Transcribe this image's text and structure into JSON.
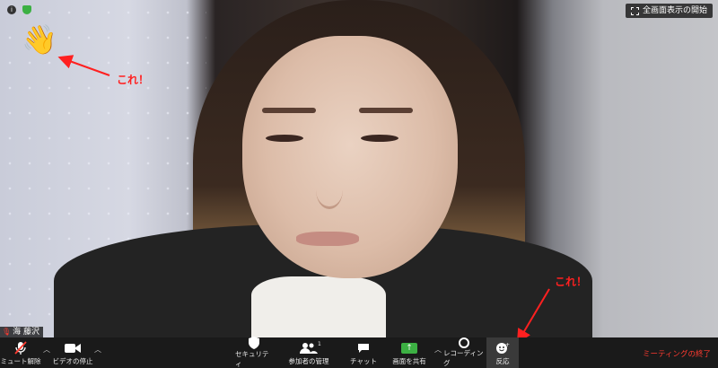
{
  "window": {
    "fullscreen_label": "全画面表示の開始"
  },
  "participant": {
    "name": "海 藤沢"
  },
  "reaction": {
    "emoji": "👋"
  },
  "annotations": [
    {
      "text": "これ！"
    },
    {
      "text": "これ！"
    }
  ],
  "toolbar": {
    "unmute_label": "ミュート解除",
    "stop_video_label": "ビデオの停止",
    "security_label": "セキュリティ",
    "participants_label": "参加者の管理",
    "participants_count": "1",
    "chat_label": "チャット",
    "share_label": "画面を共有",
    "record_label": "レコーディング",
    "reactions_label": "反応",
    "end_label": "ミーティングの終了"
  },
  "colors": {
    "accent_green": "#3cb043",
    "end_red": "#ff3b30",
    "annotation_red": "#ff2020"
  }
}
